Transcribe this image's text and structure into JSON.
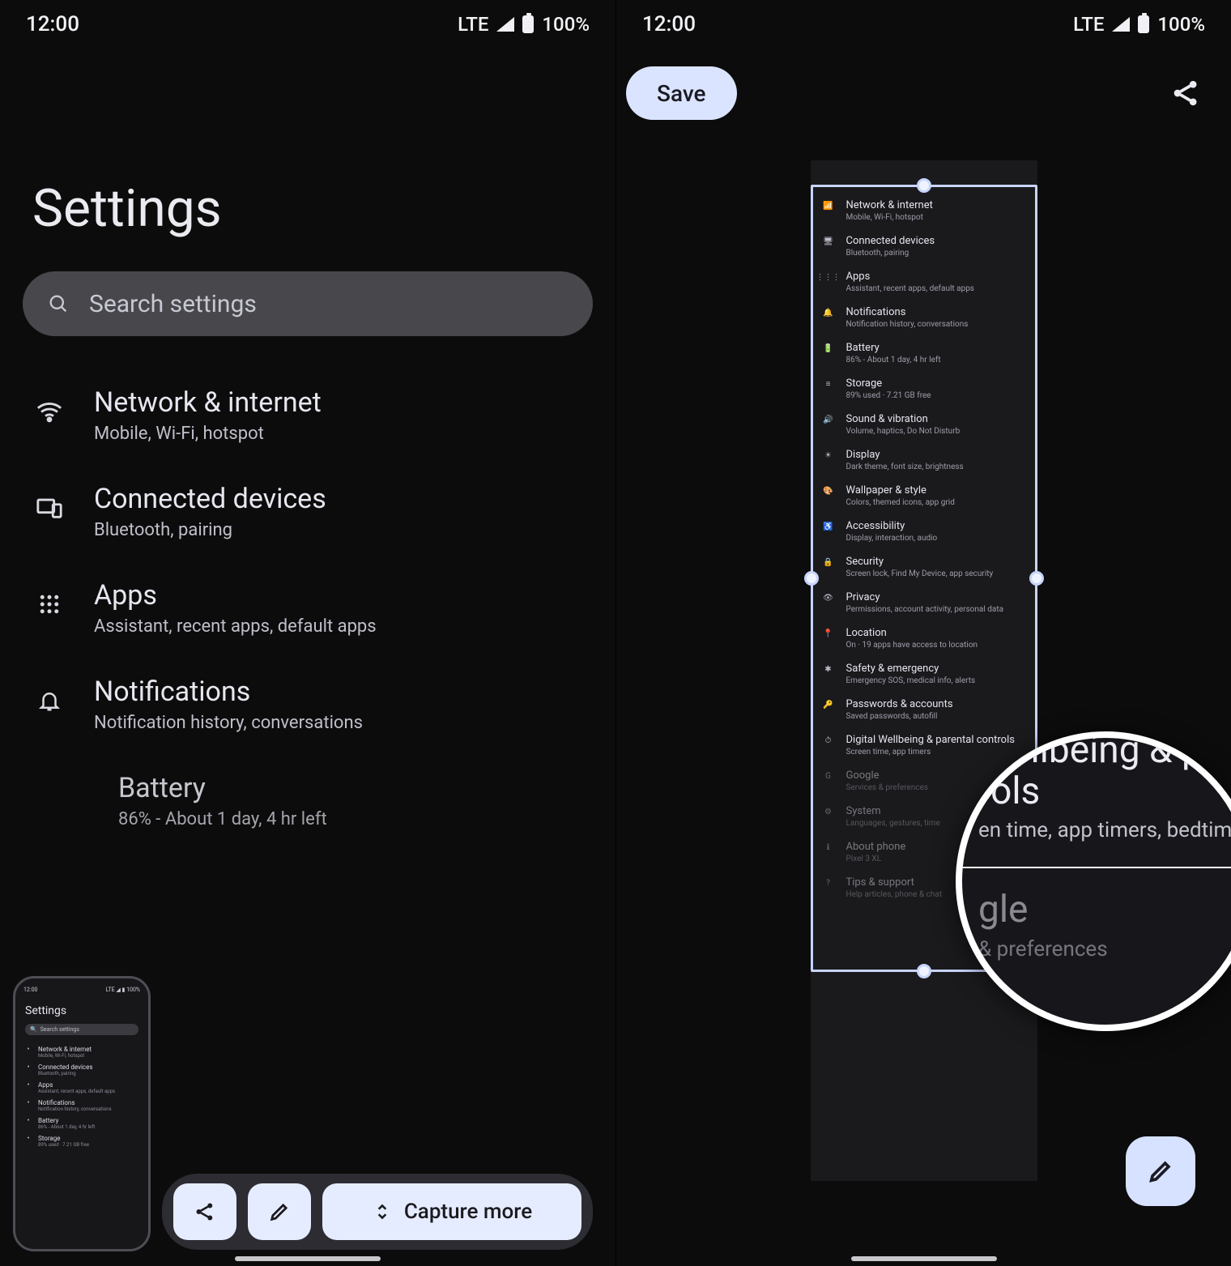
{
  "status": {
    "time": "12:00",
    "net": "LTE",
    "battery": "100%"
  },
  "left": {
    "title": "Settings",
    "search_placeholder": "Search settings",
    "items": [
      {
        "title": "Network & internet",
        "sub": "Mobile, Wi-Fi, hotspot"
      },
      {
        "title": "Connected devices",
        "sub": "Bluetooth, pairing"
      },
      {
        "title": "Apps",
        "sub": "Assistant, recent apps, default apps"
      },
      {
        "title": "Notifications",
        "sub": "Notification history, conversations"
      },
      {
        "title": "Battery",
        "sub": "86% - About 1 day, 4 hr left"
      }
    ],
    "capture_more": "Capture more",
    "thumb": {
      "title": "Settings",
      "search": "Search settings",
      "rows": [
        {
          "t": "Network & internet",
          "s": "Mobile, Wi-Fi, hotspot"
        },
        {
          "t": "Connected devices",
          "s": "Bluetooth, pairing"
        },
        {
          "t": "Apps",
          "s": "Assistant, recent apps, default apps"
        },
        {
          "t": "Notifications",
          "s": "Notification history, conversations"
        },
        {
          "t": "Battery",
          "s": "86% - About 1 day, 4 hr left"
        },
        {
          "t": "Storage",
          "s": "89% used · 7.21 GB free"
        }
      ]
    }
  },
  "right": {
    "save": "Save",
    "rows": [
      {
        "t": "Network & internet",
        "s": "Mobile, Wi-Fi, hotspot"
      },
      {
        "t": "Connected devices",
        "s": "Bluetooth, pairing"
      },
      {
        "t": "Apps",
        "s": "Assistant, recent apps, default apps"
      },
      {
        "t": "Notifications",
        "s": "Notification history, conversations"
      },
      {
        "t": "Battery",
        "s": "86% - About 1 day, 4 hr left"
      },
      {
        "t": "Storage",
        "s": "89% used · 7.21 GB free"
      },
      {
        "t": "Sound & vibration",
        "s": "Volume, haptics, Do Not Disturb"
      },
      {
        "t": "Display",
        "s": "Dark theme, font size, brightness"
      },
      {
        "t": "Wallpaper & style",
        "s": "Colors, themed icons, app grid"
      },
      {
        "t": "Accessibility",
        "s": "Display, interaction, audio"
      },
      {
        "t": "Security",
        "s": "Screen lock, Find My Device, app security"
      },
      {
        "t": "Privacy",
        "s": "Permissions, account activity, personal data"
      },
      {
        "t": "Location",
        "s": "On · 19 apps have access to location"
      },
      {
        "t": "Safety & emergency",
        "s": "Emergency SOS, medical info, alerts"
      },
      {
        "t": "Passwords & accounts",
        "s": "Saved passwords, autofill"
      },
      {
        "t": "Digital Wellbeing & parental controls",
        "s": "Screen time, app timers"
      },
      {
        "t": "Google",
        "s": "Services & preferences"
      },
      {
        "t": "System",
        "s": "Languages, gestures, time"
      },
      {
        "t": "About phone",
        "s": "Pixel 3 XL"
      },
      {
        "t": "Tips & support",
        "s": "Help articles, phone & chat"
      }
    ],
    "mag": {
      "title1": "Wellbeing & p",
      "title1b": "rols",
      "sub1": "en time, app timers, bedtim",
      "title2": "gle",
      "sub2": "& preferences"
    }
  }
}
